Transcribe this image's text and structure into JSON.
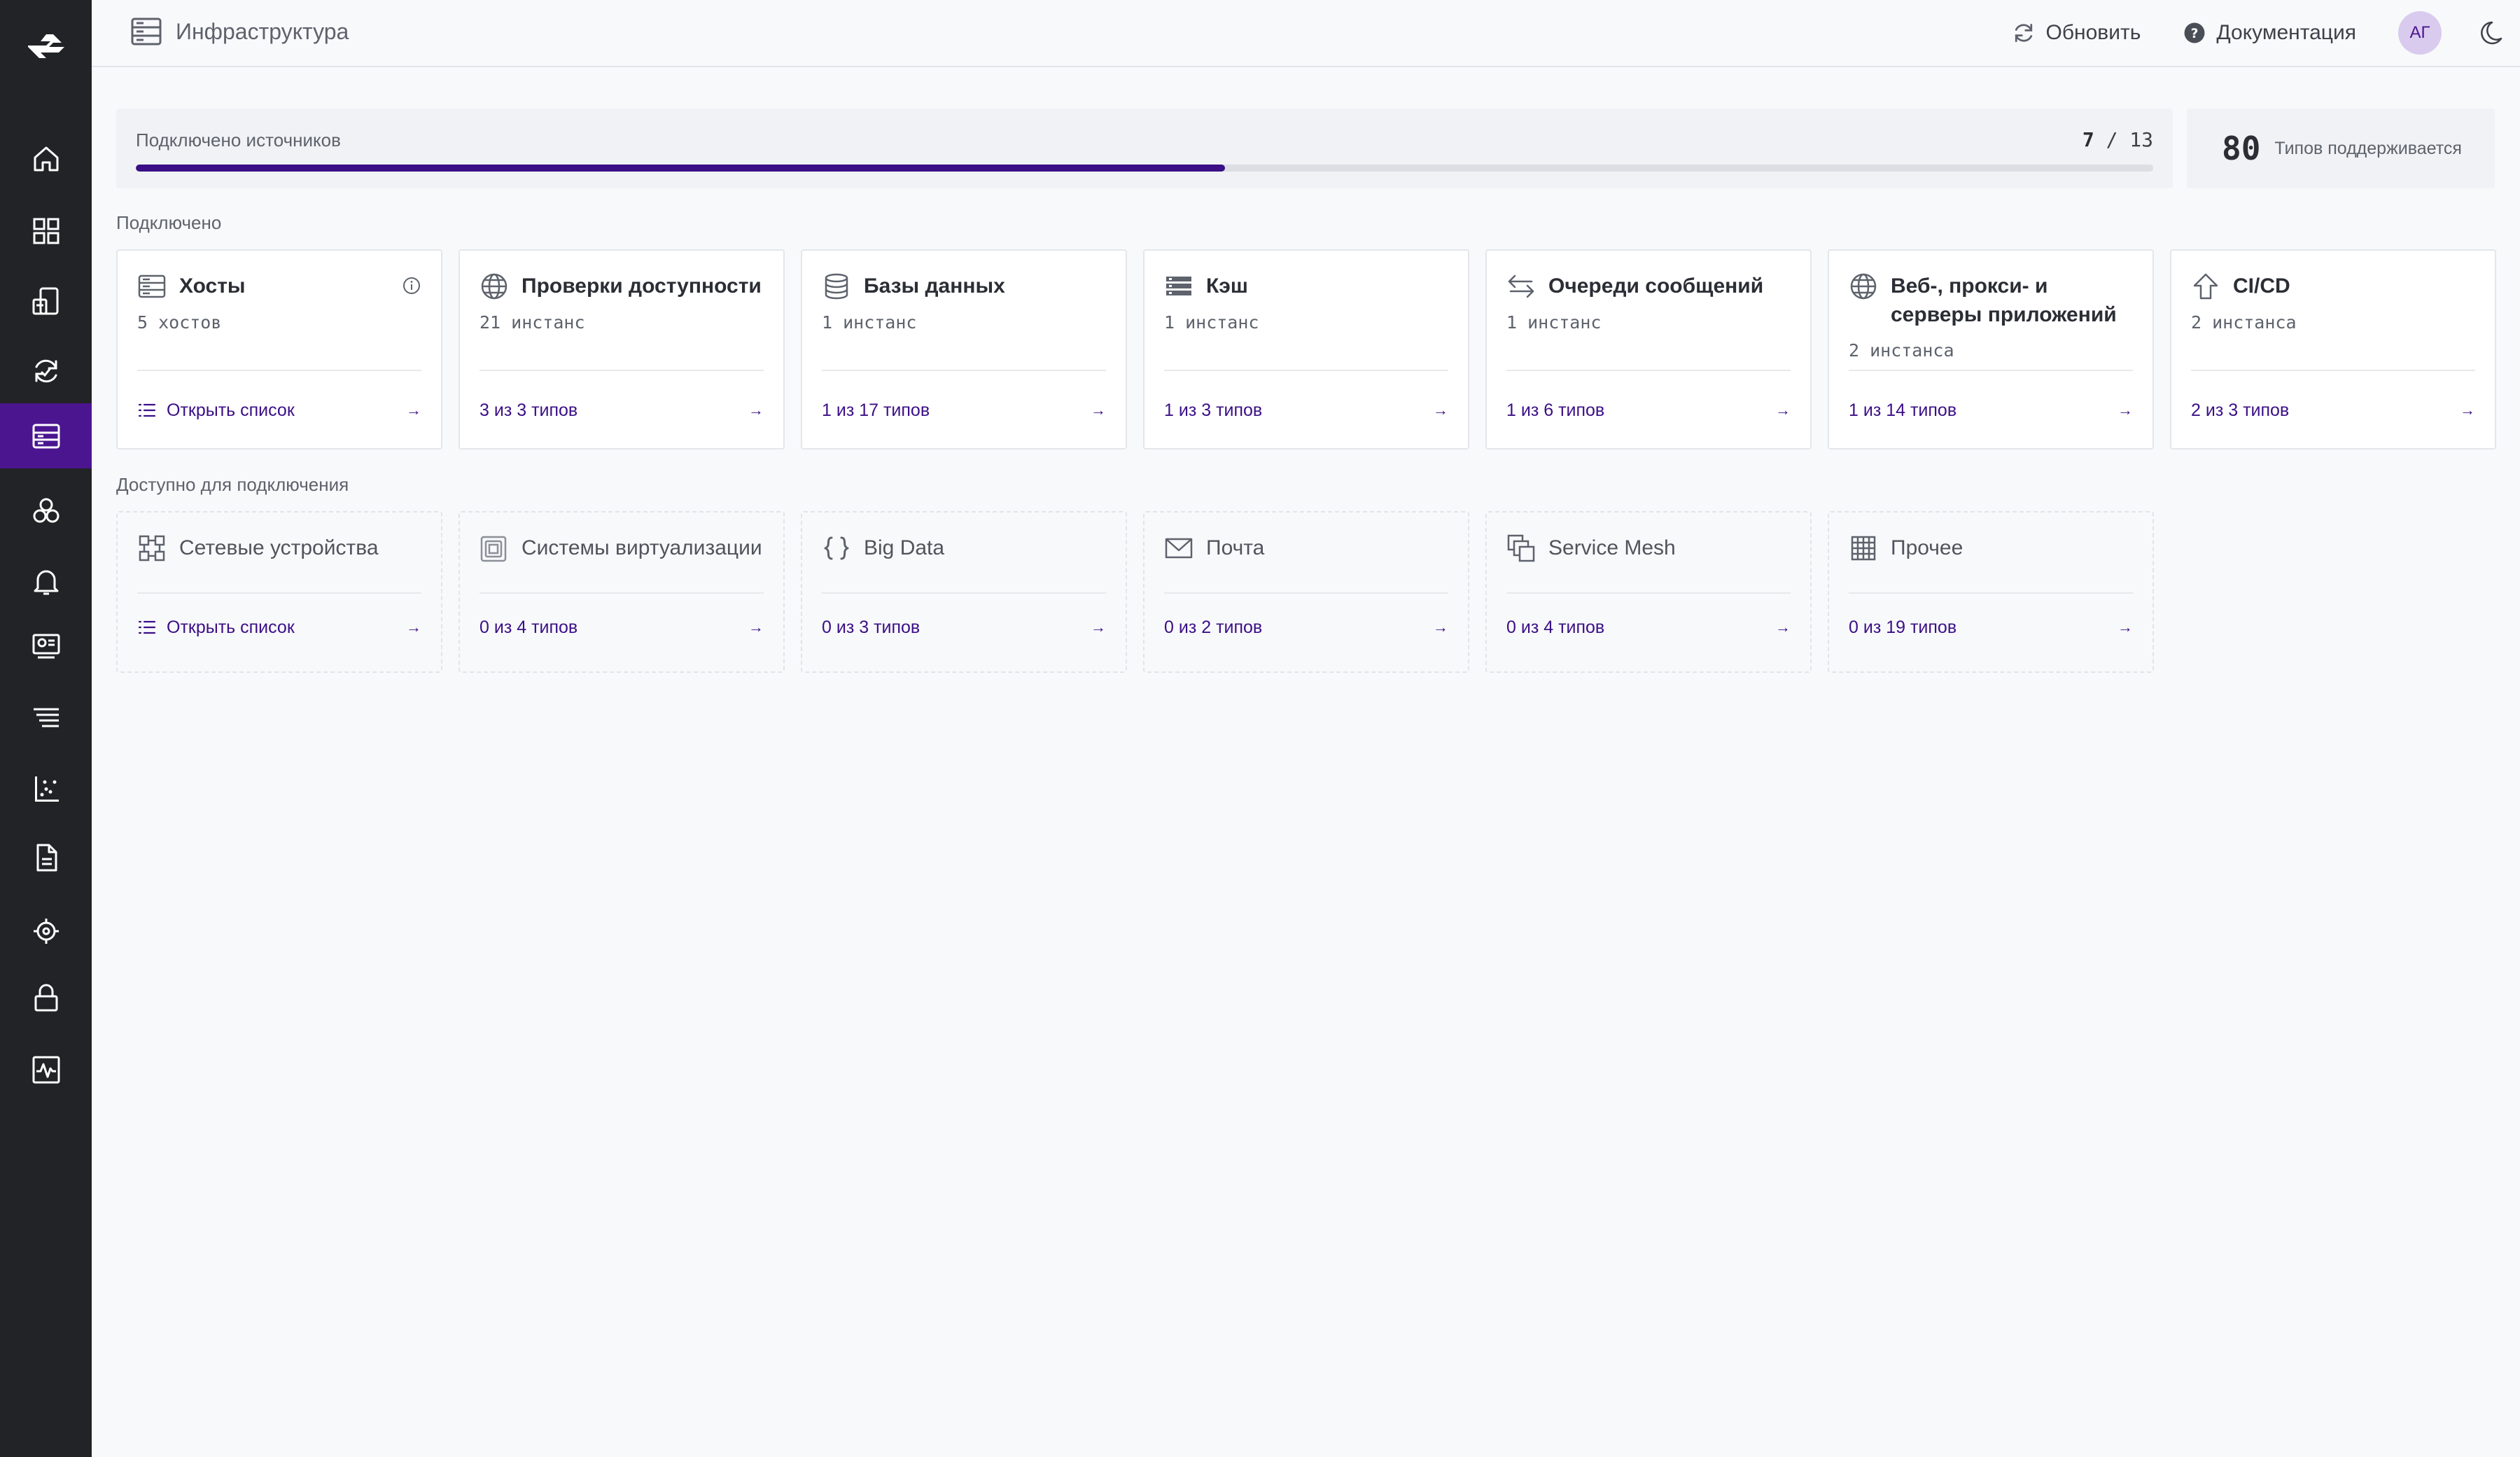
{
  "header": {
    "title": "Инфраструктура",
    "refresh_label": "Обновить",
    "docs_label": "Документация",
    "avatar_initials": "АГ"
  },
  "sidebar": {
    "items": [
      {
        "icon": "home-icon"
      },
      {
        "icon": "dashboards-icon"
      },
      {
        "icon": "services-icon"
      },
      {
        "icon": "sync-icon"
      },
      {
        "icon": "infrastructure-icon",
        "active": true
      },
      {
        "icon": "hexagons-icon"
      },
      {
        "icon": "bell-icon"
      },
      {
        "icon": "monitor-icon"
      },
      {
        "icon": "logs-icon"
      },
      {
        "icon": "metrics-icon"
      },
      {
        "icon": "document-icon"
      },
      {
        "icon": "settings-icon"
      },
      {
        "icon": "lock-icon"
      },
      {
        "icon": "activity-icon"
      }
    ]
  },
  "progress": {
    "label": "Подключено источников",
    "connected": "7",
    "separator": "/",
    "total": "13",
    "fraction": 0.54
  },
  "types": {
    "count": "80",
    "label": "Типов поддерживается"
  },
  "sections": {
    "connected_label": "Подключено",
    "available_label": "Доступно для подключения"
  },
  "connected_cards": [
    {
      "title": "Хосты",
      "subtitle": "5 хостов",
      "link": "Открыть список",
      "icon": "server-icon",
      "has_info": true,
      "has_list_icon": true
    },
    {
      "title": "Проверки доступности",
      "subtitle": "21 инстанс",
      "link": "3 из 3 типов",
      "icon": "globe-icon"
    },
    {
      "title": "Базы данных",
      "subtitle": "1 инстанс",
      "link": "1 из 17 типов",
      "icon": "database-icon"
    },
    {
      "title": "Кэш",
      "subtitle": "1 инстанс",
      "link": "1 из 3 типов",
      "icon": "cache-icon"
    },
    {
      "title": "Очереди сообщений",
      "subtitle": "1 инстанс",
      "link": "1 из 6 типов",
      "icon": "exchange-icon"
    },
    {
      "title": "Веб-, прокси- и серверы приложений",
      "subtitle": "2 инстанса",
      "link": "1 из 14 типов",
      "icon": "globe-icon"
    },
    {
      "title": "CI/CD",
      "subtitle": "2 инстанса",
      "link": "2 из 3 типов",
      "icon": "upload-arrow-icon"
    }
  ],
  "available_cards": [
    {
      "title": "Сетевые устройства",
      "link": "Открыть список",
      "icon": "network-icon",
      "has_list_icon": true
    },
    {
      "title": "Системы виртуализации",
      "link": "0 из 4 типов",
      "icon": "virtualization-icon"
    },
    {
      "title": "Big Data",
      "link": "0 из 3 типов",
      "icon": "braces-icon"
    },
    {
      "title": "Почта",
      "link": "0 из 2 типов",
      "icon": "mail-icon"
    },
    {
      "title": "Service Mesh",
      "link": "0 из 4 типов",
      "icon": "mesh-icon"
    },
    {
      "title": "Прочее",
      "link": "0 из 19 типов",
      "icon": "grid-icon"
    }
  ],
  "colors": {
    "accent": "#3b0f86",
    "sidebar_bg": "#222326",
    "sidebar_active": "#4b1590"
  }
}
